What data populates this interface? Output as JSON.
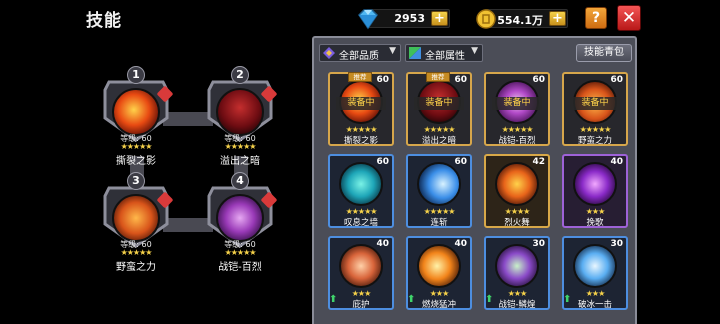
{
  "header": {
    "title": "技能"
  },
  "currency": {
    "gems": {
      "value": "2953",
      "icon": "diamond-icon"
    },
    "coins": {
      "value": "554.1万",
      "icon": "coin-icon"
    },
    "plus_label": "+"
  },
  "buttons": {
    "help": "?",
    "close": "✕"
  },
  "equipped": [
    {
      "slot": "1",
      "level": "等级: 60",
      "stars": "★★★★★",
      "name": "撕裂之影"
    },
    {
      "slot": "2",
      "level": "等级: 60",
      "stars": "★★★★★",
      "name": "溢出之暗"
    },
    {
      "slot": "3",
      "level": "等级: 60",
      "stars": "★★★★★",
      "name": "野蛮之力"
    },
    {
      "slot": "4",
      "level": "等级: 60",
      "stars": "★★★★★",
      "name": "战铠-百烈"
    }
  ],
  "panel": {
    "filter_quality": "全部品质",
    "filter_attr": "全部属性",
    "bag_button": "技能青包",
    "equipped_label": "装备中",
    "recommend_label": "推荐",
    "skills": [
      {
        "name": "撕裂之影",
        "level": "60",
        "stars": "★★★★★",
        "tier": "gold",
        "equipped": true,
        "recommend": true
      },
      {
        "name": "溢出之暗",
        "level": "60",
        "stars": "★★★★★",
        "tier": "gold",
        "equipped": true,
        "recommend": true
      },
      {
        "name": "战铠-百烈",
        "level": "60",
        "stars": "★★★★★",
        "tier": "gold",
        "equipped": true,
        "recommend": false
      },
      {
        "name": "野蛮之力",
        "level": "60",
        "stars": "★★★★★",
        "tier": "gold",
        "equipped": true,
        "recommend": false
      },
      {
        "name": "叹息之墙",
        "level": "60",
        "stars": "★★★★★",
        "tier": "blue",
        "equipped": false,
        "recommend": false
      },
      {
        "name": "连斩",
        "level": "60",
        "stars": "★★★★★",
        "tier": "blue",
        "equipped": false,
        "recommend": false
      },
      {
        "name": "烈火舞",
        "level": "42",
        "stars": "★★★★",
        "tier": "gold",
        "equipped": false,
        "recommend": false
      },
      {
        "name": "挽歌",
        "level": "40",
        "stars": "★★★",
        "tier": "purple",
        "equipped": false,
        "recommend": false
      },
      {
        "name": "庇护",
        "level": "40",
        "stars": "★★★",
        "tier": "blue",
        "equipped": false,
        "recommend": false,
        "upgrade": true
      },
      {
        "name": "燃烧猛冲",
        "level": "40",
        "stars": "★★★",
        "tier": "blue",
        "equipped": false,
        "recommend": false,
        "upgrade": true
      },
      {
        "name": "战铠-鳞煌",
        "level": "30",
        "stars": "★★★",
        "tier": "blue",
        "equipped": false,
        "recommend": false,
        "upgrade": true
      },
      {
        "name": "破冰一击",
        "level": "30",
        "stars": "★★★",
        "tier": "blue",
        "equipped": false,
        "recommend": false,
        "upgrade": true
      }
    ]
  }
}
